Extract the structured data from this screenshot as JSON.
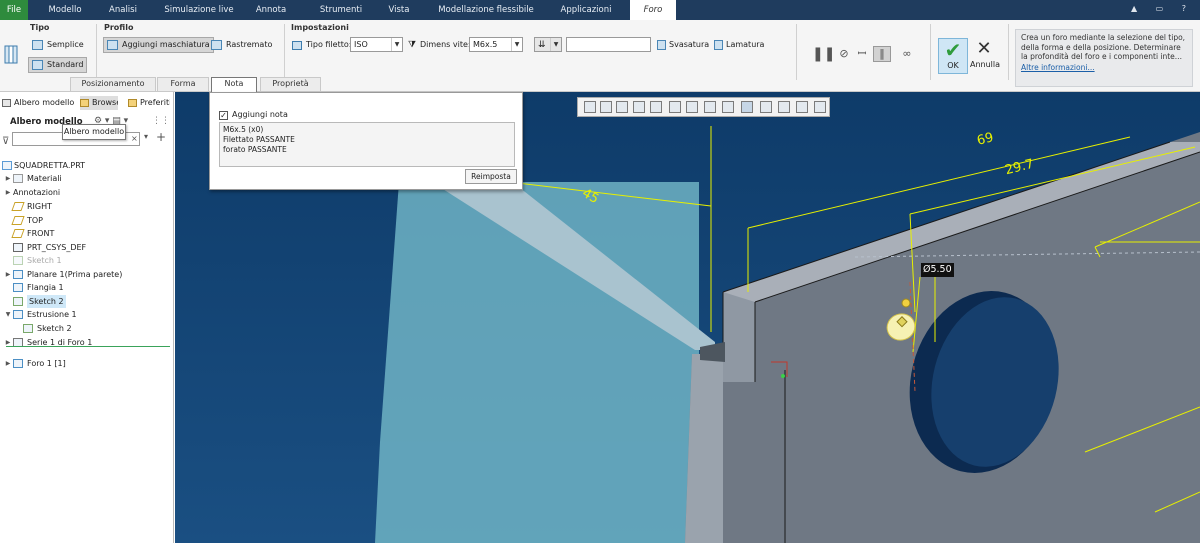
{
  "menubar": {
    "items": [
      "File",
      "Modello",
      "Analisi",
      "Simulazione live",
      "Annota",
      "Strumenti",
      "Vista",
      "Modellazione flessibile",
      "Applicazioni",
      "Foro"
    ]
  },
  "ribbon": {
    "tipo": {
      "title": "Tipo",
      "semplice": "Semplice",
      "standard": "Standard"
    },
    "profilo": {
      "title": "Profilo",
      "maschiatura": "Aggiungi maschiatura",
      "rastremato": "Rastremato"
    },
    "impostazioni": {
      "title": "Impostazioni",
      "tipo_filetto_label": "Tipo filetto:",
      "tipo_filetto_value": "ISO",
      "dimens_vite_label": "Dimens vite:",
      "dimens_vite_value": "M6x.5",
      "svasatura": "Svasatura",
      "lamatura": "Lamatura"
    },
    "tabs": [
      "Posizionamento",
      "Forma",
      "Nota",
      "Proprietà"
    ],
    "active_tab": "Nota",
    "ok_label": "OK",
    "cancel_label": "Annulla",
    "info_text": "Crea un foro mediante la selezione del tipo, della forma e della posizione. Determinare la profondità del foro e i componenti inte...",
    "info_link": "Altre informazioni..."
  },
  "left_panel": {
    "tabs": [
      "Albero modello",
      "Browser",
      "Preferiti"
    ],
    "tree_title": "Albero modello",
    "tooltip": "Albero modello",
    "items": [
      {
        "label": "SQUADRETTA.PRT",
        "level": 0,
        "twisty": "",
        "icon": "part"
      },
      {
        "label": "Materiali",
        "level": 1,
        "twisty": "▶",
        "icon": "material"
      },
      {
        "label": "Annotazioni",
        "level": 1,
        "twisty": "▶",
        "icon": ""
      },
      {
        "label": "RIGHT",
        "level": 1,
        "twisty": "",
        "icon": "plane"
      },
      {
        "label": "TOP",
        "level": 1,
        "twisty": "",
        "icon": "plane"
      },
      {
        "label": "FRONT",
        "level": 1,
        "twisty": "",
        "icon": "plane"
      },
      {
        "label": "PRT_CSYS_DEF",
        "level": 1,
        "twisty": "",
        "icon": "csys"
      },
      {
        "label": "Sketch 1",
        "level": 1,
        "twisty": "",
        "icon": "sketch",
        "dim": true
      },
      {
        "label": "Planare 1(Prima parete)",
        "level": 1,
        "twisty": "▶",
        "icon": "wall"
      },
      {
        "label": "Flangia 1",
        "level": 1,
        "twisty": "",
        "icon": "flange"
      },
      {
        "label": "Sketch 2",
        "level": 1,
        "twisty": "",
        "icon": "sketch",
        "highlight": true
      },
      {
        "label": "Estrusione 1",
        "level": 1,
        "twisty": "▼",
        "icon": "extrude"
      },
      {
        "label": "Sketch 2",
        "level": 2,
        "twisty": "",
        "icon": "sketch"
      },
      {
        "label": "Serie 1 di Foro 1",
        "level": 1,
        "twisty": "▶",
        "icon": "pattern"
      },
      {
        "label": "Foro 1 [1]",
        "level": 1,
        "twisty": "▶",
        "icon": "hole"
      }
    ]
  },
  "nota_panel": {
    "checkbox_label": "Aggiungi nota",
    "checked": true,
    "lines": [
      "M6x.5 (x0)",
      "Filettato  PASSANTE",
      "forato  PASSANTE"
    ],
    "reset_label": "Reimposta"
  },
  "viewport": {
    "dims": {
      "d69": "69",
      "d297": "29.7",
      "d45": "45",
      "d550": "Ø5.50"
    }
  },
  "colors": {
    "menubar": "#1f3c5e",
    "file_tab": "#2e8b3d",
    "viewport_bg": "#14426f",
    "dimension": "#e7f000"
  }
}
